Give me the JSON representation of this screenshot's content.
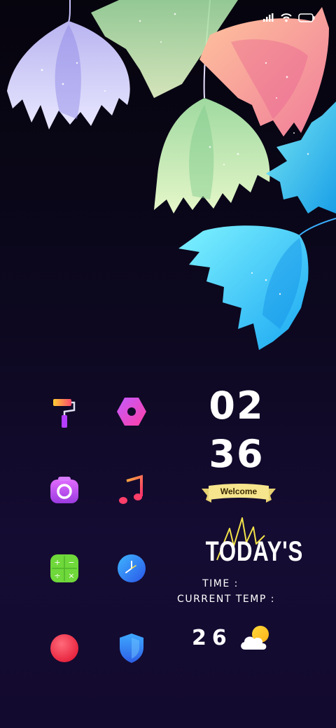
{
  "status_bar": {
    "icons": [
      "signal-icon",
      "wifi-icon",
      "battery-icon"
    ]
  },
  "apps": [
    {
      "name": "themes-app",
      "icon": "paint-roller-icon"
    },
    {
      "name": "settings-app",
      "icon": "hex-nut-icon"
    },
    {
      "name": "camera-app",
      "icon": "camera-icon"
    },
    {
      "name": "music-app",
      "icon": "music-note-icon"
    },
    {
      "name": "calculator-app",
      "icon": "calculator-icon"
    },
    {
      "name": "clock-app",
      "icon": "clock-icon"
    },
    {
      "name": "recorder-app",
      "icon": "red-circle-icon"
    },
    {
      "name": "security-app",
      "icon": "shield-icon"
    }
  ],
  "widget": {
    "hour": "02",
    "minute": "36",
    "ribbon_text": "Welcome",
    "headline": "TODAY'S",
    "time_label": "TIME :",
    "temp_label": "CURRENT TEMP :",
    "temperature": "26",
    "weather_icon": "partly-cloudy-icon"
  },
  "colors": {
    "background_top": "#06040d",
    "background_bottom": "#150c33",
    "ribbon": "#f6e58d",
    "scribble": "#f1e24a"
  }
}
